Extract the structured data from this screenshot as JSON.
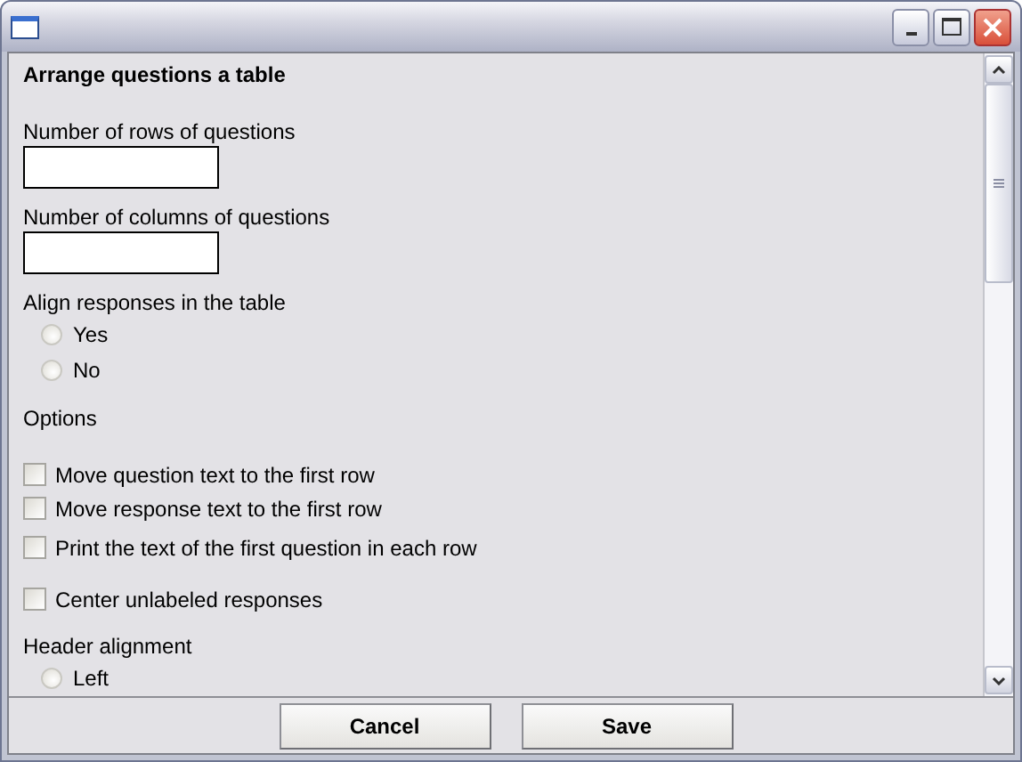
{
  "content": [
    {
      "kind": "heading",
      "text": "Arrange questions a table"
    },
    {
      "kind": "text_field",
      "label": "Number of rows of questions"
    },
    {
      "kind": "text_field",
      "label": "Number of columns of questions"
    },
    {
      "kind": "radio_group",
      "label": "Align responses in the table",
      "options": [
        {
          "label": "Yes",
          "selected": false
        },
        {
          "label": "No",
          "selected": false
        }
      ]
    },
    {
      "kind": "label",
      "text": "Options"
    },
    {
      "kind": "checkbox",
      "label": "Move question text to the first row",
      "checked": false
    },
    {
      "kind": "checkbox",
      "label": "Move response text to the first row",
      "checked": false
    },
    {
      "kind": "checkbox",
      "label": "Print the text of the first question in each row",
      "checked": false
    },
    {
      "kind": "checkbox",
      "label": "Center unlabeled responses",
      "checked": false
    },
    {
      "kind": "radio_group",
      "label": "Header alignment",
      "options": [
        {
          "label": "Left",
          "selected": false
        }
      ]
    }
  ],
  "buttons": [
    "Cancel",
    "Save"
  ]
}
